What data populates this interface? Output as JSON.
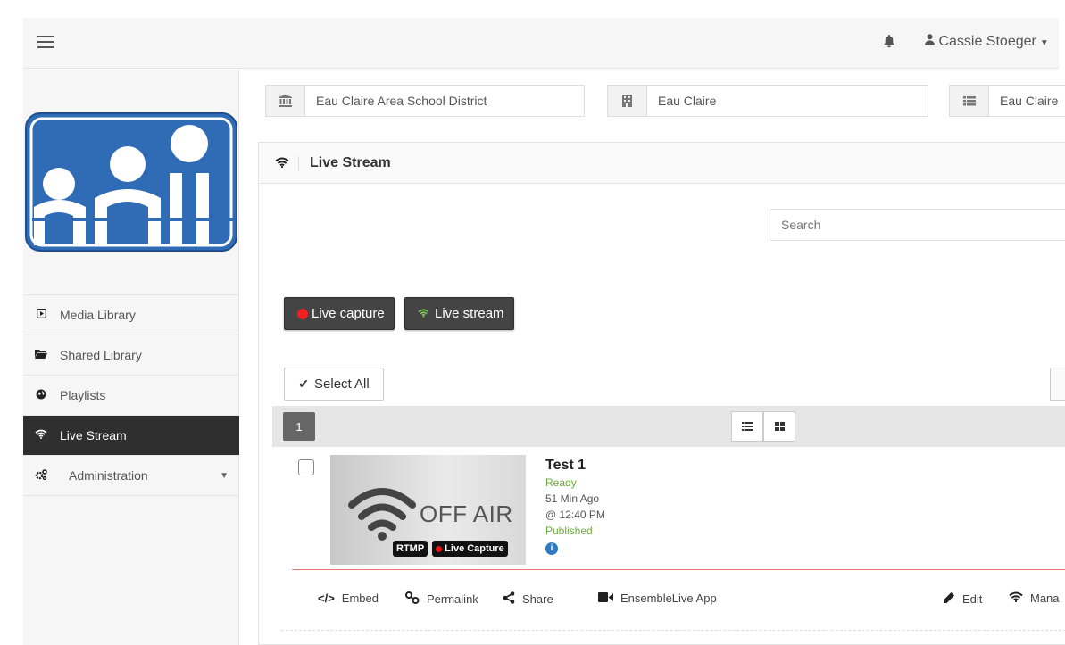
{
  "topbar": {
    "menu_icon": "hamburger-icon",
    "bell_icon": "bell-icon",
    "user_icon": "user-icon",
    "user_name": "Cassie Stoeger"
  },
  "selectors": [
    {
      "icon": "institution-icon",
      "value": "Eau Claire Area School District"
    },
    {
      "icon": "building-icon",
      "value": "Eau Claire"
    },
    {
      "icon": "list-icon",
      "value": "Eau Claire"
    }
  ],
  "sidebar": {
    "items": [
      {
        "icon": "play-square-icon",
        "label": "Media Library"
      },
      {
        "icon": "folder-open-icon",
        "label": "Shared Library"
      },
      {
        "icon": "globe-icon",
        "label": "Playlists"
      },
      {
        "icon": "wifi-icon",
        "label": "Live Stream",
        "active": true
      },
      {
        "icon": "cogs-icon",
        "label": "Administration",
        "has_dropdown": true
      }
    ]
  },
  "panel": {
    "title": "Live Stream",
    "search_placeholder": "Search",
    "live_capture_label": "Live capture",
    "live_stream_label": "Live stream",
    "select_all_label": "Select All",
    "page": "1"
  },
  "item": {
    "name": "Test 1",
    "status": "Ready",
    "age": "51 Min Ago",
    "time": "@ 12:40 PM",
    "publish_state": "Published",
    "thumb_text": "OFF AIR",
    "badge_rtmp": "RTMP",
    "badge_capture": "Live Capture",
    "actions": {
      "embed": "Embed",
      "permalink": "Permalink",
      "share": "Share",
      "app": "EnsembleLive App",
      "edit": "Edit",
      "manage": "Mana"
    }
  },
  "colors": {
    "accent_blue": "#2f6cb5",
    "active_nav": "#2f2f2f",
    "status_green": "#6cab3c",
    "live_red": "#f02020"
  }
}
